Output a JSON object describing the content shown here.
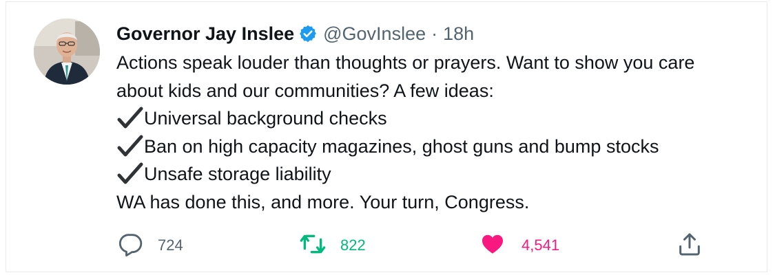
{
  "tweet": {
    "author_name": "Governor Jay Inslee",
    "handle": "@GovInslee",
    "separator": "·",
    "time": "18h",
    "lines": [
      {
        "check": false,
        "text": "Actions speak louder than thoughts or prayers. Want to show you care"
      },
      {
        "check": false,
        "text": "about kids and our communities? A few ideas:"
      },
      {
        "check": true,
        "text": "Universal background checks"
      },
      {
        "check": true,
        "text": "Ban on high capacity magazines, ghost guns and bump stocks"
      },
      {
        "check": true,
        "text": "Unsafe storage liability"
      },
      {
        "check": false,
        "text": "WA has done this, and more. Your turn, Congress."
      }
    ]
  },
  "actions": {
    "reply_count": "724",
    "retweet_count": "822",
    "like_count": "4,541"
  },
  "icons": {
    "verified": "verified-badge-icon",
    "check": "check-mark-icon",
    "reply": "reply-icon",
    "retweet": "retweet-icon",
    "like": "heart-icon",
    "share": "share-icon"
  },
  "colors": {
    "verified_blue": "#1d9bf0",
    "secondary_text": "#536471",
    "retweet_green": "#00ba7c",
    "like_pink": "#f91880"
  }
}
